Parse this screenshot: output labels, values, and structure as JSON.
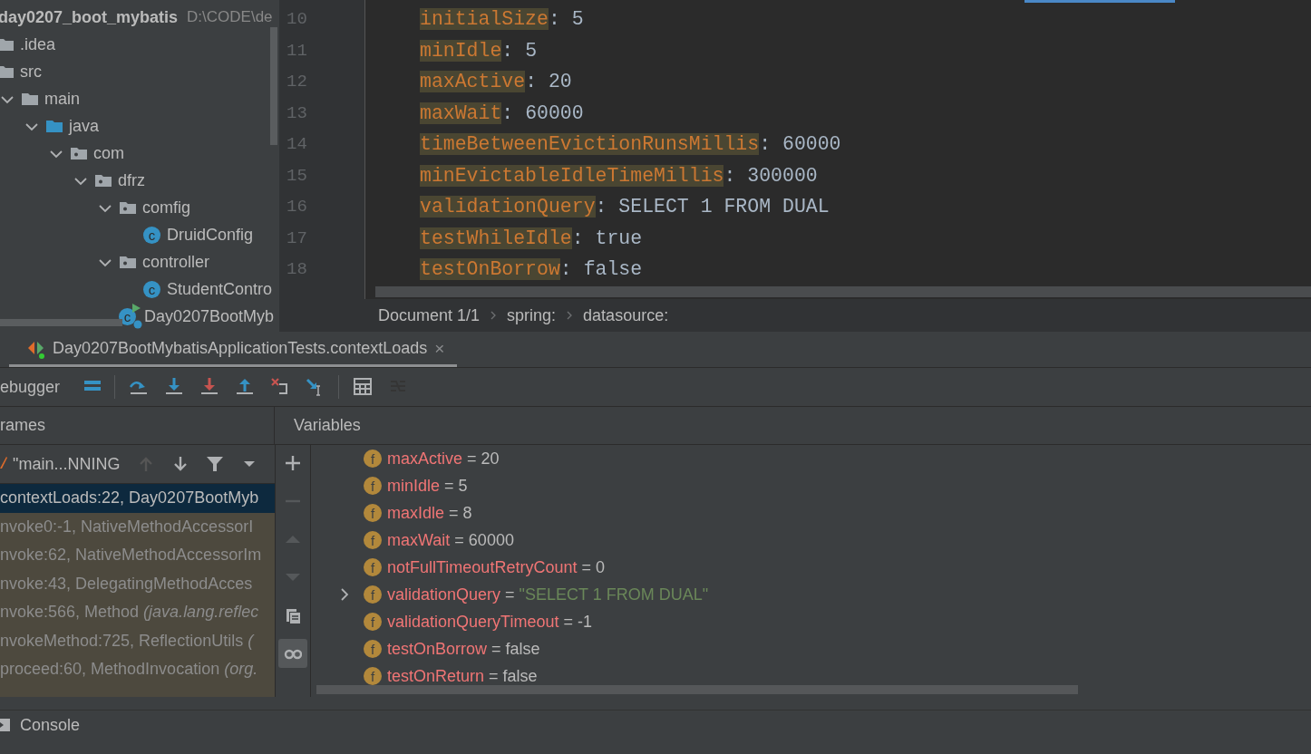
{
  "project": {
    "root_name": "day0207_boot_mybatis",
    "root_path": "D:\\CODE\\de",
    "items": [
      {
        "label": ".idea",
        "kind": "folder"
      },
      {
        "label": "src",
        "kind": "folder",
        "children": [
          {
            "label": "main",
            "kind": "folder",
            "expanded": true,
            "children": [
              {
                "label": "java",
                "kind": "source-folder",
                "expanded": true,
                "children": [
                  {
                    "label": "com",
                    "kind": "package",
                    "expanded": true,
                    "children": [
                      {
                        "label": "dfrz",
                        "kind": "package",
                        "expanded": true,
                        "children": [
                          {
                            "label": "comfig",
                            "kind": "package",
                            "expanded": true,
                            "children": [
                              {
                                "label": "DruidConfig",
                                "kind": "class",
                                "badge": "c"
                              }
                            ]
                          },
                          {
                            "label": "controller",
                            "kind": "package",
                            "expanded": true,
                            "children": [
                              {
                                "label": "StudentContro",
                                "kind": "class",
                                "badge": "c"
                              }
                            ]
                          },
                          {
                            "label": "Day0207BootMyb",
                            "kind": "app-class",
                            "badge": "c"
                          }
                        ]
                      }
                    ]
                  }
                ]
              }
            ]
          }
        ]
      }
    ]
  },
  "editor": {
    "lines": [
      {
        "number": "10",
        "key": "initialSize",
        "rest": ": 5"
      },
      {
        "number": "11",
        "key": "minIdle",
        "rest": ": 5"
      },
      {
        "number": "12",
        "key": "maxActive",
        "rest": ": 20"
      },
      {
        "number": "13",
        "key": "maxWait",
        "rest": ": 60000"
      },
      {
        "number": "14",
        "key": "timeBetweenEvictionRunsMillis",
        "rest": ": 60000"
      },
      {
        "number": "15",
        "key": "minEvictableIdleTimeMillis",
        "rest": ": 300000"
      },
      {
        "number": "16",
        "key": "validationQuery",
        "rest": ": SELECT 1 FROM DUAL"
      },
      {
        "number": "17",
        "key": "testWhileIdle",
        "rest": ": true"
      },
      {
        "number": "18",
        "key": "testOnBorrow",
        "rest": ": false"
      }
    ],
    "breadcrumbs": [
      "Document 1/1",
      "spring:",
      "datasource:"
    ]
  },
  "debugger": {
    "tab": {
      "title": "Day0207BootMybatisApplicationTests.contextLoads",
      "close": "×"
    },
    "toolbar_label": "ebugger",
    "tools": [
      {
        "kind": "layout",
        "disabled": false
      },
      {
        "kind": "step-over",
        "disabled": false
      },
      {
        "kind": "step-into",
        "disabled": false
      },
      {
        "kind": "force-step-into",
        "disabled": false
      },
      {
        "kind": "step-out",
        "disabled": false
      },
      {
        "kind": "drop-frame",
        "disabled": false
      },
      {
        "kind": "run-to-cursor",
        "disabled": false
      },
      {
        "kind": "evaluate",
        "disabled": false
      },
      {
        "kind": "trace",
        "disabled": true
      }
    ],
    "frames": {
      "header": "rames",
      "thread": "\"main...NNING",
      "thread_tools": [
        {
          "kind": "up",
          "disabled": true
        },
        {
          "kind": "down",
          "disabled": false
        },
        {
          "kind": "filter",
          "disabled": false
        },
        {
          "kind": "dropdown",
          "disabled": false
        }
      ],
      "rows": [
        {
          "text": "contextLoads:22, Day0207BootMyb",
          "selected": true,
          "library": false
        },
        {
          "text": "nvoke0:-1, NativeMethodAccessorI",
          "selected": false,
          "library": true
        },
        {
          "text": "nvoke:62, NativeMethodAccessorIm",
          "selected": false,
          "library": true
        },
        {
          "text": "nvoke:43, DelegatingMethodAcces",
          "selected": false,
          "library": true
        },
        {
          "text": "nvoke:566, Method *(java.lang.reflec*",
          "selected": false,
          "library": true
        },
        {
          "text": "nvokeMethod:725, ReflectionUtils *(*",
          "selected": false,
          "library": true
        },
        {
          "text": "proceed:60, MethodInvocation *(org.*",
          "selected": false,
          "library": true
        }
      ]
    },
    "variables": {
      "header": "Variables",
      "side_tools": [
        {
          "kind": "add",
          "disabled": false,
          "selected": false
        },
        {
          "kind": "remove",
          "disabled": true,
          "selected": false
        },
        {
          "kind": "up",
          "disabled": true,
          "selected": false
        },
        {
          "kind": "down",
          "disabled": true,
          "selected": false
        },
        {
          "kind": "copy",
          "disabled": false,
          "selected": false
        },
        {
          "kind": "watches",
          "disabled": false,
          "selected": true
        }
      ],
      "rows": [
        {
          "badge": "f",
          "name": "maxActive",
          "value": "20",
          "kind": "plain"
        },
        {
          "badge": "f",
          "name": "minIdle",
          "value": "5",
          "kind": "plain"
        },
        {
          "badge": "f",
          "name": "maxIdle",
          "value": "8",
          "kind": "plain"
        },
        {
          "badge": "f",
          "name": "maxWait",
          "value": "60000",
          "kind": "plain"
        },
        {
          "badge": "f",
          "name": "notFullTimeoutRetryCount",
          "value": "0",
          "kind": "plain"
        },
        {
          "badge": "f",
          "name": "validationQuery",
          "value": "\"SELECT 1 FROM DUAL\"",
          "kind": "string",
          "expanded": false
        },
        {
          "badge": "f",
          "name": "validationQueryTimeout",
          "value": "-1",
          "kind": "plain"
        },
        {
          "badge": "f",
          "name": "testOnBorrow",
          "value": "false",
          "kind": "plain"
        },
        {
          "badge": "f",
          "name": "testOnReturn",
          "value": "false",
          "kind": "plain"
        }
      ],
      "equals": "="
    },
    "console": "Console"
  }
}
